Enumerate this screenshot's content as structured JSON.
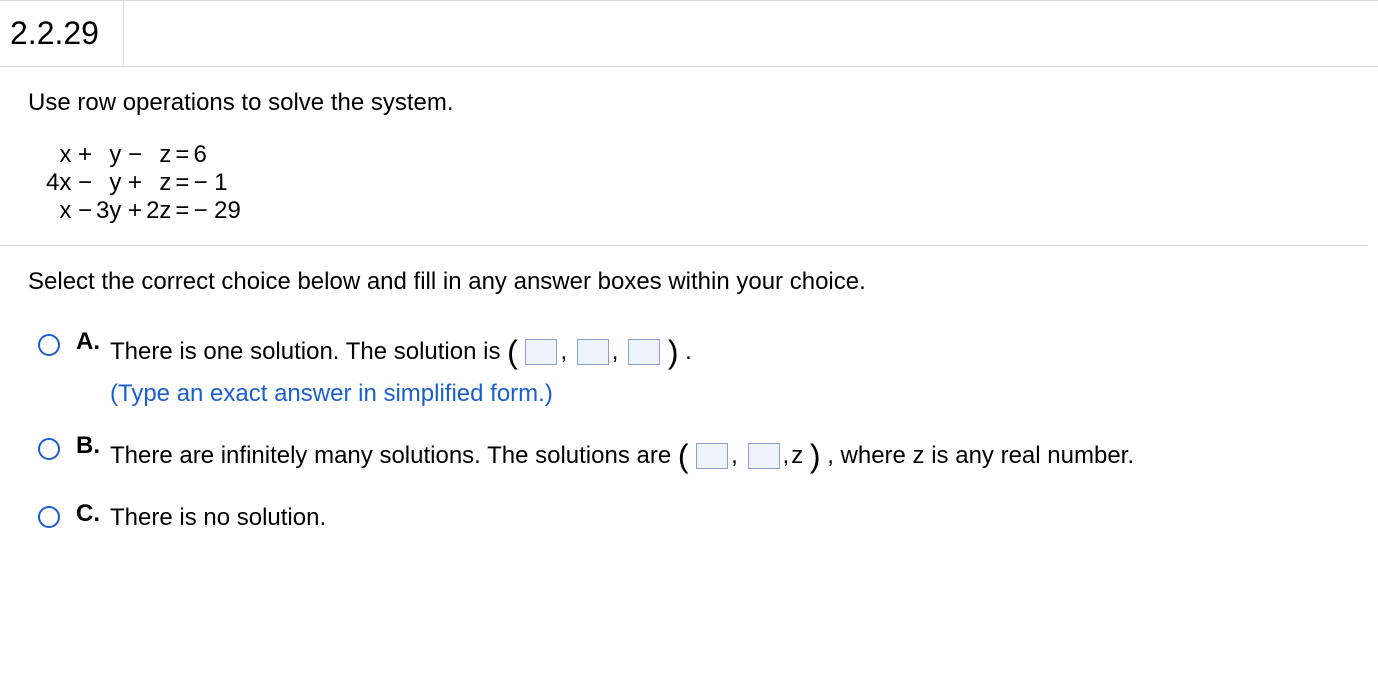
{
  "question_number": "2.2.29",
  "instruction": "Use row operations to solve the system.",
  "equations": {
    "r1": {
      "c1": "x +",
      "c2": "y −",
      "c3": "z",
      "eq": "=",
      "rhs": "6"
    },
    "r2": {
      "c1": "4x −",
      "c2": "y +",
      "c3": "z",
      "eq": "=",
      "rhs": "− 1"
    },
    "r3": {
      "c1": "x −",
      "c2": "3y +",
      "c3": "2z",
      "eq": "=",
      "rhs": "− 29"
    }
  },
  "select_prompt": "Select the correct choice below and fill in any answer boxes within your choice.",
  "choices": {
    "A": {
      "letter": "A.",
      "pre": "There is one solution. The solution is ",
      "post": " .",
      "hint": "(Type an exact answer in simplified form.)"
    },
    "B": {
      "letter": "B.",
      "pre": "There are infinitely many solutions. The solutions are ",
      "zlabel": "z",
      "post": " , where z is any real number."
    },
    "C": {
      "letter": "C.",
      "text": "There is no solution."
    }
  }
}
